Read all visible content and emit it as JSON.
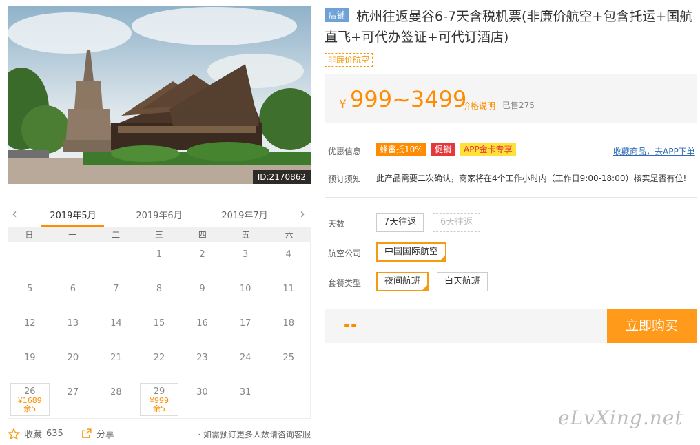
{
  "hero": {
    "id_label": "ID:2170862"
  },
  "product": {
    "shop_tag": "店铺",
    "title": "杭州往返曼谷6-7天含税机票(非廉价航空+包含托运+国航直飞+可代办签证+可代订酒店)",
    "low_cost_tag": "非廉价航空",
    "price_currency": "¥",
    "price_range": "999~3499",
    "price_explain": "价格说明",
    "sold": "已售275"
  },
  "calendar": {
    "months": [
      "2019年5月",
      "2019年6月",
      "2019年7月"
    ],
    "weekdays": [
      "日",
      "一",
      "二",
      "三",
      "四",
      "五",
      "六"
    ],
    "cells": [
      {
        "day": ""
      },
      {
        "day": ""
      },
      {
        "day": ""
      },
      {
        "day": "1"
      },
      {
        "day": "2"
      },
      {
        "day": "3"
      },
      {
        "day": "4"
      },
      {
        "day": "5"
      },
      {
        "day": "6"
      },
      {
        "day": "7"
      },
      {
        "day": "8"
      },
      {
        "day": "9"
      },
      {
        "day": "10"
      },
      {
        "day": "11"
      },
      {
        "day": "12"
      },
      {
        "day": "13"
      },
      {
        "day": "14"
      },
      {
        "day": "15"
      },
      {
        "day": "16"
      },
      {
        "day": "17"
      },
      {
        "day": "18"
      },
      {
        "day": "19"
      },
      {
        "day": "20"
      },
      {
        "day": "21"
      },
      {
        "day": "22"
      },
      {
        "day": "23"
      },
      {
        "day": "24"
      },
      {
        "day": "25"
      },
      {
        "day": "26",
        "price": "¥1689",
        "stock": "余5"
      },
      {
        "day": "27"
      },
      {
        "day": "28"
      },
      {
        "day": "29",
        "price": "¥999",
        "stock": "余5"
      },
      {
        "day": "30"
      },
      {
        "day": "31"
      },
      {
        "day": ""
      }
    ]
  },
  "footer": {
    "favorite_label": "收藏",
    "favorite_count": "635",
    "share_label": "分享",
    "note": "· 如需预订更多人数请咨询客服"
  },
  "info": {
    "promo_label": "优惠信息",
    "promos": [
      "蜂蜜抵10%",
      "促销",
      "APP金卡专享"
    ],
    "app_link": "收藏商品，去APP下单",
    "notice_label": "预订须知",
    "notice": "此产品需要二次确认，商家将在4个工作小时内（工作日9:00-18:00）核实是否有位!"
  },
  "options": {
    "days_label": "天数",
    "days": [
      "7天往返",
      "6天往返"
    ],
    "airline_label": "航空公司",
    "airline": [
      "中国国际航空"
    ],
    "package_label": "套餐类型",
    "package": [
      "夜间航班",
      "白天航班"
    ]
  },
  "buy": {
    "total": "--",
    "button": "立即购买"
  },
  "watermark": "eLvXing.net",
  "colors": {
    "accent": "#ff8c00",
    "promo_red": "#e4393c",
    "promo_yellow": "#ffe13a",
    "link": "#2c6ab1"
  }
}
